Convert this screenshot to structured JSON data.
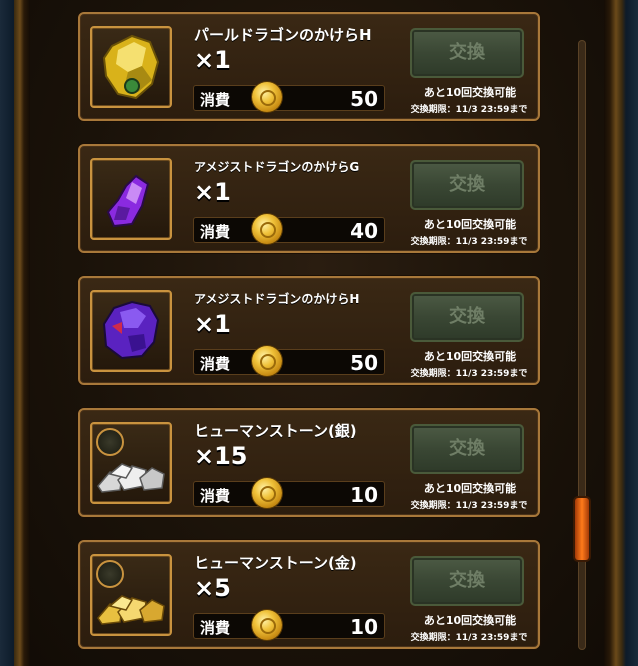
{
  "items": [
    {
      "name": "パールドラゴンのかけらH",
      "qty": "×1",
      "cost_label": "消費",
      "cost": "50",
      "button": "交換",
      "remain": "あと10回交換可能",
      "deadline": "交換期限：11/3 23:59まで",
      "icon": "pearl-dragon-fragment-icon",
      "color": "#e0c21a"
    },
    {
      "name": "アメジストドラゴンのかけらG",
      "qty": "×1",
      "cost_label": "消費",
      "cost": "40",
      "button": "交換",
      "remain": "あと10回交換可能",
      "deadline": "交換期限：11/3 23:59まで",
      "icon": "amethyst-dragon-fragment-icon",
      "color": "#8a2ae0"
    },
    {
      "name": "アメジストドラゴンのかけらH",
      "qty": "×1",
      "cost_label": "消費",
      "cost": "50",
      "button": "交換",
      "remain": "あと10回交換可能",
      "deadline": "交換期限：11/3 23:59まで",
      "icon": "amethyst-dragon-fragment-icon",
      "color": "#6a2ad0"
    },
    {
      "name": "ヒューマンストーン(銀)",
      "qty": "×15",
      "cost_label": "消費",
      "cost": "10",
      "button": "交換",
      "remain": "あと10回交換可能",
      "deadline": "交換期限：11/3 23:59まで",
      "icon": "silver-human-stone-icon",
      "color": "#c8c8c8"
    },
    {
      "name": "ヒューマンストーン(金)",
      "qty": "×5",
      "cost_label": "消費",
      "cost": "10",
      "button": "交換",
      "remain": "あと10回交換可能",
      "deadline": "交換期限：11/3 23:59まで",
      "icon": "gold-human-stone-icon",
      "color": "#f0c23a"
    }
  ]
}
